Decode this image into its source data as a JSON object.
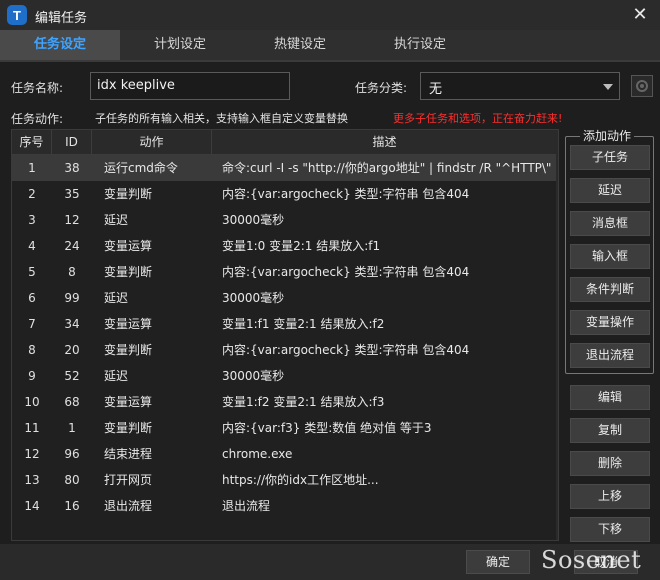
{
  "window": {
    "title": "编辑任务",
    "app_icon_letter": "T",
    "close_glyph": "✕"
  },
  "tabs": [
    {
      "label": "任务设定",
      "active": true
    },
    {
      "label": "计划设定",
      "active": false
    },
    {
      "label": "热键设定",
      "active": false
    },
    {
      "label": "执行设定",
      "active": false
    }
  ],
  "form": {
    "name_label": "任务名称:",
    "name_value": "idx keeplive",
    "category_label": "任务分类:",
    "category_value": "无",
    "actions_label": "任务动作:",
    "hint": "子任务的所有输入相关，支持输入框自定义变量替换",
    "hint_red": "更多子任务和选项，正在奋力赶来!"
  },
  "table": {
    "headers": {
      "no": "序号",
      "id": "ID",
      "action": "动作",
      "desc": "描述"
    },
    "rows": [
      {
        "no": "1",
        "id": "38",
        "action": "运行cmd命令",
        "desc": "命令:curl -I -s \"http://你的argo地址\" | findstr /R \"^HTTP\\\" ..."
      },
      {
        "no": "2",
        "id": "35",
        "action": "变量判断",
        "desc": "内容:{var:argocheck} 类型:字符串 包含404"
      },
      {
        "no": "3",
        "id": "12",
        "action": "延迟",
        "desc": "30000毫秒"
      },
      {
        "no": "4",
        "id": "24",
        "action": "变量运算",
        "desc": "变量1:0 变量2:1 结果放入:f1"
      },
      {
        "no": "5",
        "id": "8",
        "action": "变量判断",
        "desc": "内容:{var:argocheck} 类型:字符串 包含404"
      },
      {
        "no": "6",
        "id": "99",
        "action": "延迟",
        "desc": "30000毫秒"
      },
      {
        "no": "7",
        "id": "34",
        "action": "变量运算",
        "desc": "变量1:f1 变量2:1 结果放入:f2"
      },
      {
        "no": "8",
        "id": "20",
        "action": "变量判断",
        "desc": "内容:{var:argocheck} 类型:字符串 包含404"
      },
      {
        "no": "9",
        "id": "52",
        "action": "延迟",
        "desc": "30000毫秒"
      },
      {
        "no": "10",
        "id": "68",
        "action": "变量运算",
        "desc": "变量1:f2 变量2:1 结果放入:f3"
      },
      {
        "no": "11",
        "id": "1",
        "action": "变量判断",
        "desc": "内容:{var:f3} 类型:数值 绝对值 等于3"
      },
      {
        "no": "12",
        "id": "96",
        "action": "结束进程",
        "desc": "chrome.exe"
      },
      {
        "no": "13",
        "id": "80",
        "action": "打开网页",
        "desc": "https://你的idx工作区地址..."
      },
      {
        "no": "14",
        "id": "16",
        "action": "退出流程",
        "desc": "退出流程"
      }
    ]
  },
  "add_actions": {
    "title": "添加动作",
    "buttons": [
      "子任务",
      "延迟",
      "消息框",
      "输入框",
      "条件判断",
      "变量操作",
      "退出流程"
    ]
  },
  "edit_buttons": [
    "编辑",
    "复制",
    "删除",
    "上移",
    "下移"
  ],
  "footer": {
    "ok": "确定",
    "cancel": "取消"
  },
  "watermark": "Sosenet"
}
